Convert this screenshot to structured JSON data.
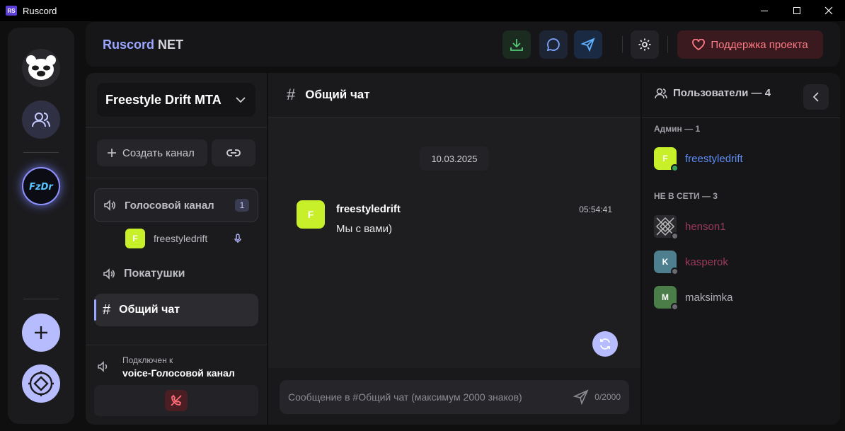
{
  "window": {
    "title": "Ruscord",
    "logo_text": "RS"
  },
  "header": {
    "brand_primary": "Ruscord",
    "brand_secondary": "NET",
    "support_label": "Поддержка проекта",
    "icons": [
      "download-icon",
      "chat-icon",
      "send-icon",
      "gear-icon",
      "heart-icon"
    ]
  },
  "rail": {
    "items": [
      "bear-logo",
      "friends-icon",
      "server-freestyle-drift",
      "add-server-icon",
      "discover-icon"
    ]
  },
  "channels": {
    "server_name": "Freestyle Drift MTA",
    "create_channel_label": "Создать канал",
    "voice_channel": {
      "name": "Голосовой канал",
      "count": "1",
      "users": [
        {
          "initial": "F",
          "name": "freestyledrift"
        }
      ]
    },
    "text_channels": [
      {
        "name": "Покатушки",
        "type": "voice"
      },
      {
        "name": "Общий чат",
        "type": "text",
        "active": true
      }
    ],
    "connection": {
      "status_label": "Подключен к",
      "channel_label": "voice-Голосовой канал"
    }
  },
  "chat": {
    "channel_title": "Общий чат",
    "date_divider": "10.03.2025",
    "messages": [
      {
        "initial": "F",
        "author": "freestyledrift",
        "time": "05:54:41",
        "text": "Мы с вами)"
      }
    ],
    "composer": {
      "placeholder": "Сообщение в #Общий чат (максимум 2000 знаков)",
      "value": "",
      "char_count": "0/2000"
    }
  },
  "users": {
    "title": "Пользователи — 4",
    "sections": [
      {
        "label": "Админ — 1",
        "members": [
          {
            "initial": "F",
            "name": "freestyledrift",
            "color": "#5e8ef5",
            "avatar_bg": "#c7f02a",
            "status": "online"
          }
        ]
      },
      {
        "label": "НЕ В СЕТИ — 3",
        "members": [
          {
            "initial": "",
            "name": "henson1",
            "color": "#9c3a5a",
            "avatar_bg": "#333",
            "status": "offline"
          },
          {
            "initial": "K",
            "name": "kasperok",
            "color": "#9c3a5a",
            "avatar_bg": "#4d7f8f",
            "status": "offline"
          },
          {
            "initial": "M",
            "name": "maksimka",
            "color": "#b0b0b8",
            "avatar_bg": "#4a7d48",
            "status": "offline"
          }
        ]
      }
    ]
  },
  "colors": {
    "accent": "#9aa6ff",
    "avatar_lime": "#c7f02a",
    "danger": "#ff7a86",
    "online": "#3ba55c",
    "offline": "#6b6b72"
  }
}
